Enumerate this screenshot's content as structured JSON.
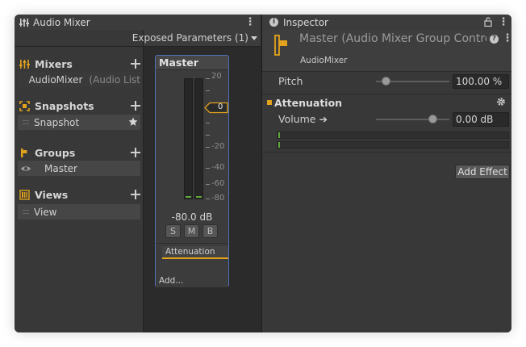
{
  "mixer": {
    "tab_label": "Audio Mixer",
    "exposed_params": "Exposed Parameters (1)",
    "sections": {
      "mixers": {
        "title": "Mixers",
        "item_name": "AudioMixer",
        "item_detail": "(Audio List"
      },
      "snapshots": {
        "title": "Snapshots",
        "item_name": "Snapshot"
      },
      "groups": {
        "title": "Groups",
        "item_name": "Master"
      },
      "views": {
        "title": "Views",
        "item_name": "View"
      }
    },
    "strip": {
      "title": "Master",
      "scale": [
        "20",
        "0",
        "-20",
        "-40",
        "-60",
        "-80"
      ],
      "fader_value": "0",
      "db_readout": "-80.0 dB",
      "buttons": [
        "S",
        "M",
        "B"
      ],
      "effect": "Attenuation",
      "add": "Add..."
    }
  },
  "inspector": {
    "tab_label": "Inspector",
    "title": "Master (Audio Mixer Group Controller)",
    "subtitle": "AudioMixer",
    "pitch": {
      "label": "Pitch",
      "value": "100.00 %",
      "fraction": 0.14
    },
    "attenuation": {
      "title": "Attenuation",
      "volume_label": "Volume ➔",
      "volume_value": "0.00 dB",
      "fraction": 0.78
    },
    "add_effect": "Add Effect"
  },
  "colors": {
    "accent": "#e2a21c",
    "selection": "#4f70b8",
    "level": "#5fa63c"
  }
}
